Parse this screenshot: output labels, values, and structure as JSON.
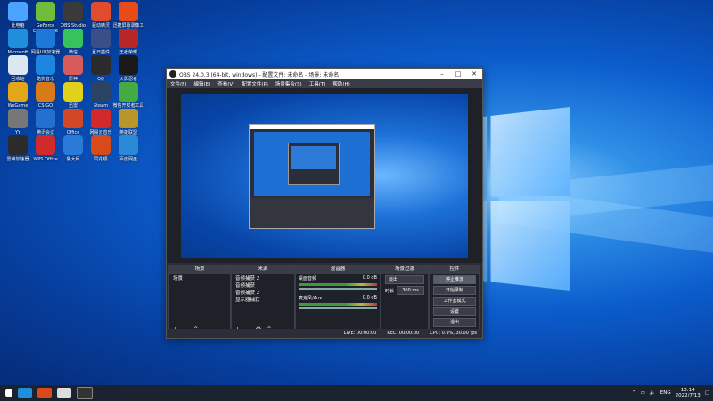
{
  "desktop": {
    "icons": [
      {
        "label": "此电脑",
        "color": "#4aa3ff"
      },
      {
        "label": "GeForce Experience",
        "color": "#6fbd3a"
      },
      {
        "label": "OBS Studio",
        "color": "#3a3a3a"
      },
      {
        "label": "驱动精灵",
        "color": "#e24b2c"
      },
      {
        "label": "迅捷屏幕录像工具",
        "color": "#e84b1a"
      },
      {
        "label": "Microsoft Edge",
        "color": "#1f8fdc"
      },
      {
        "label": "网易UU加速器",
        "color": "#1d78d8"
      },
      {
        "label": "微信",
        "color": "#36c25d"
      },
      {
        "label": "夏日插件",
        "color": "#3b4f86"
      },
      {
        "label": "王者荣耀",
        "color": "#b82727"
      },
      {
        "label": "回收站",
        "color": "#dde7f2"
      },
      {
        "label": "酷狗音乐",
        "color": "#1d86e3"
      },
      {
        "label": "原神",
        "color": "#d85a5a"
      },
      {
        "label": "QQ",
        "color": "#2b2b2b"
      },
      {
        "label": "火影忍者",
        "color": "#1a1a1a"
      },
      {
        "label": "WeGame",
        "color": "#e3a51a"
      },
      {
        "label": "CS:GO",
        "color": "#d87a1a"
      },
      {
        "label": "迅雷",
        "color": "#e2d11a"
      },
      {
        "label": "Steam",
        "color": "#2a4363"
      },
      {
        "label": "微信开发者工具",
        "color": "#44aa44"
      },
      {
        "label": "YY",
        "color": "#777"
      },
      {
        "label": "腾讯会议",
        "color": "#2470d0"
      },
      {
        "label": "Office",
        "color": "#d24726"
      },
      {
        "label": "网易云音乐",
        "color": "#d22a2a"
      },
      {
        "label": "英雄联盟",
        "color": "#b8962a"
      },
      {
        "label": "雷神加速器",
        "color": "#2b2b2b"
      },
      {
        "label": "WPS Office",
        "color": "#d02a2a"
      },
      {
        "label": "鲁大师",
        "color": "#2a7ad8"
      },
      {
        "label": "同花顺",
        "color": "#d84a1a"
      },
      {
        "label": "百度网盘",
        "color": "#2a8ad8"
      }
    ]
  },
  "obs": {
    "title": "OBS 24.0.3 (64-bit, windows) - 配置文件: 未命名 - 场景: 未命名",
    "menu": [
      "文件(F)",
      "编辑(E)",
      "查看(V)",
      "配置文件(P)",
      "场景集合(S)",
      "工具(T)",
      "帮助(H)"
    ],
    "panels": {
      "scenes": {
        "title": "场景",
        "items": [
          "场景"
        ]
      },
      "sources": {
        "title": "来源",
        "items": [
          "音频捕获 2",
          "音频捕获",
          "音频捕获 2",
          "显示器捕获"
        ]
      },
      "mixer": {
        "title": "混音器",
        "rows": [
          {
            "name": "桌面音频",
            "db": "0.0 dB"
          },
          {
            "name": "麦克风/Aux",
            "db": "0.0 dB"
          }
        ]
      },
      "transitions": {
        "title": "场景过渡",
        "type": "淡出",
        "duration_label": "时长",
        "duration": "300 ms"
      },
      "controls": {
        "title": "控件",
        "buttons": [
          "停止推流",
          "开始录制",
          "工作室模式",
          "设置",
          "退出"
        ]
      }
    },
    "status": {
      "live": "LIVE: 00:00:00",
      "rec": "REC: 00:00:00",
      "cpu": "CPU: 0.9%, 30.00 fps"
    }
  },
  "taskbar": {
    "lang": "ENG",
    "time": "13:14",
    "date": "2022/7/13"
  }
}
